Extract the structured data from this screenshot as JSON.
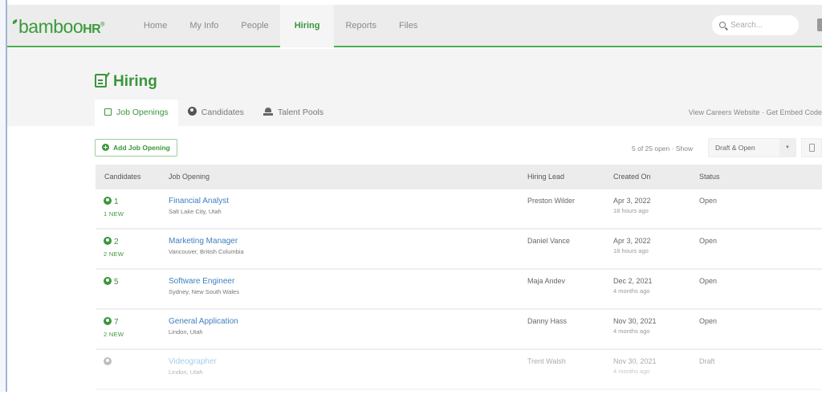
{
  "app": {
    "logo": {
      "leaf": "",
      "main": "bamboo",
      "suffix": "HR",
      "mark": "®"
    },
    "accent_color": "#3a963a",
    "link_color": "#3f7fc0"
  },
  "nav": {
    "items": [
      {
        "label": "Home",
        "active": false
      },
      {
        "label": "My Info",
        "active": false
      },
      {
        "label": "People",
        "active": false
      },
      {
        "label": "Hiring",
        "active": true
      },
      {
        "label": "Reports",
        "active": false
      },
      {
        "label": "Files",
        "active": false
      }
    ],
    "search_placeholder": "Search..."
  },
  "page": {
    "title": "Hiring",
    "tabs": [
      {
        "label": "Job Openings",
        "icon": "job-openings-icon",
        "active": true
      },
      {
        "label": "Candidates",
        "icon": "candidate-icon",
        "active": false
      },
      {
        "label": "Talent Pools",
        "icon": "talent-pools-icon",
        "active": false
      }
    ],
    "links": {
      "careers": "View Careers Website",
      "separator": "·",
      "embed": "Get Embed Code"
    }
  },
  "toolbar": {
    "add_label": "Add Job Opening",
    "count_text": "5 of 25 open",
    "separator": "·",
    "show_label": "Show",
    "filter_value": "Draft & Open"
  },
  "table": {
    "headers": [
      "Candidates",
      "Job Opening",
      "Hiring Lead",
      "Created On",
      "Status"
    ],
    "rows": [
      {
        "candidates": "1",
        "new": "1 NEW",
        "title": "Financial Analyst",
        "location": "Salt Lake City, Utah",
        "lead": "Preston Wilder",
        "created": "Apr 3, 2022",
        "created_ago": "18 hours ago",
        "status": "Open"
      },
      {
        "candidates": "2",
        "new": "2 NEW",
        "title": "Marketing Manager",
        "location": "Vancouver, British Columbia",
        "lead": "Daniel Vance",
        "created": "Apr 3, 2022",
        "created_ago": "18 hours ago",
        "status": "Open"
      },
      {
        "candidates": "5",
        "new": "",
        "title": "Software Engineer",
        "location": "Sydney, New South Wales",
        "lead": "Maja Andev",
        "created": "Dec 2, 2021",
        "created_ago": "4 months ago",
        "status": "Open"
      },
      {
        "candidates": "7",
        "new": "2 NEW",
        "title": "General Application",
        "location": "Lindon, Utah",
        "lead": "Danny Hass",
        "created": "Nov 30, 2021",
        "created_ago": "4 months ago",
        "status": "Open"
      },
      {
        "candidates": "",
        "new": "",
        "title": "Videographer",
        "location": "Lindon, Utah",
        "lead": "Trent Walsh",
        "created": "Nov 30, 2021",
        "created_ago": "4 months ago",
        "status": "Draft"
      }
    ]
  }
}
